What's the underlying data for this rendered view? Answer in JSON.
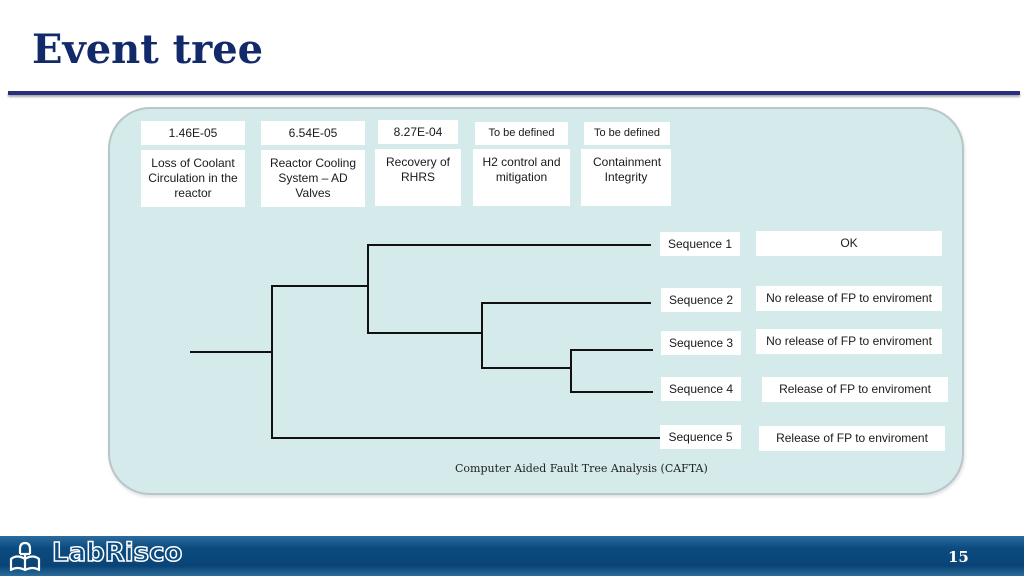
{
  "title": "Event tree",
  "columns": [
    {
      "value": "1.46E-05",
      "label": "Loss of Coolant Circulation in the reactor"
    },
    {
      "value": "6.54E-05",
      "label": "Reactor Cooling System – AD Valves"
    },
    {
      "value": "8.27E-04",
      "label": "Recovery of RHRS"
    },
    {
      "value": "To be defined",
      "label": "H2 control and mitigation"
    },
    {
      "value": "To be defined",
      "label": "Containment Integrity"
    }
  ],
  "sequences": [
    {
      "name": "Sequence 1",
      "outcome": "OK"
    },
    {
      "name": "Sequence 2",
      "outcome": "No release of FP to enviroment"
    },
    {
      "name": "Sequence 3",
      "outcome": "No release of FP to enviroment"
    },
    {
      "name": "Sequence 4",
      "outcome": "Release of FP to enviroment"
    },
    {
      "name": "Sequence 5",
      "outcome": "Release of FP to enviroment"
    }
  ],
  "caption": "Computer Aided Fault Tree Analysis (CAFTA)",
  "footer": {
    "logo": "LabRisco",
    "page": "15"
  }
}
